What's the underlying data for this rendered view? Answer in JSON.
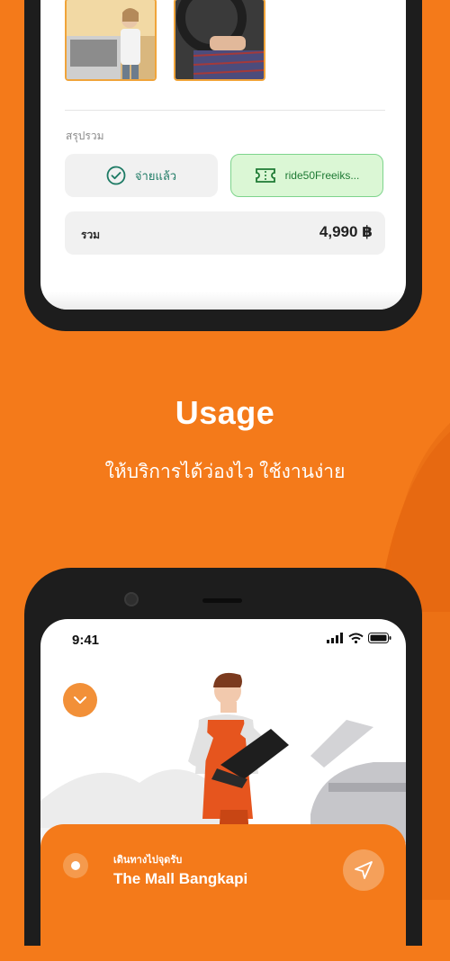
{
  "summary": {
    "label": "สรุปรวม",
    "paid_status": "จ่ายแล้ว",
    "coupon_code": "ride50Freeiks...",
    "total_label": "รวม",
    "total_amount": "4,990 ฿"
  },
  "headline": {
    "title": "Usage",
    "subtitle": "ให้บริการได้ว่องไว ใช้งานง่าย"
  },
  "device": {
    "time": "9:41"
  },
  "navigation": {
    "caption": "เดินทางไปจุดรับ",
    "place": "The Mall Bangkapi"
  },
  "colors": {
    "brand_orange": "#f47a1a",
    "paid_green": "#1d7a64",
    "coupon_bg": "#dbf7d5"
  },
  "icons": {
    "paid": "check-circle-icon",
    "coupon": "ticket-icon",
    "collapse": "chevron-down-icon",
    "navigate": "navigation-arrow-icon"
  }
}
